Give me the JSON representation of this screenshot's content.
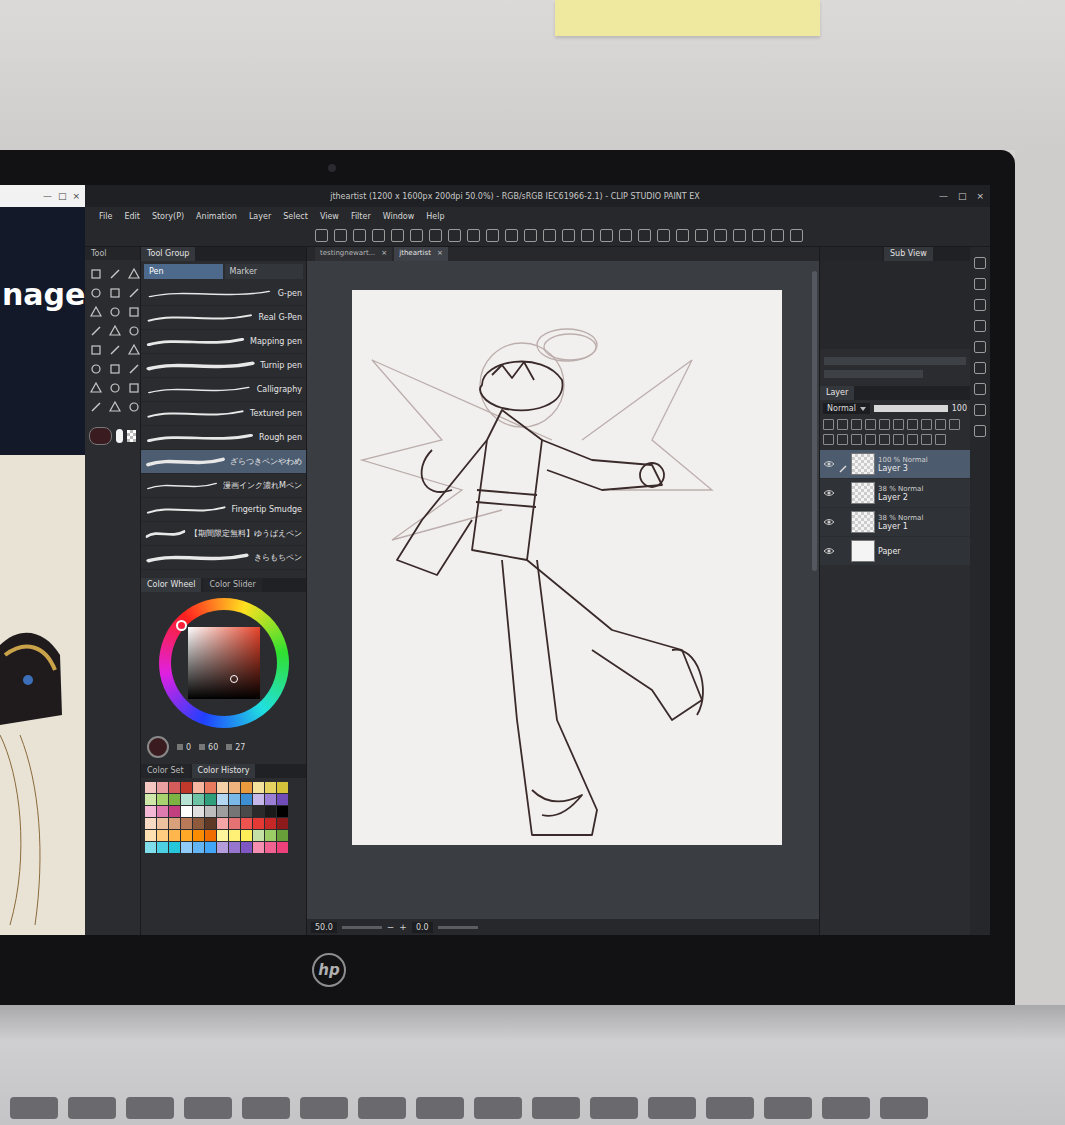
{
  "background_window": {
    "heading": "nage",
    "window_controls": [
      "—",
      "□",
      "×"
    ]
  },
  "app": {
    "title": "jtheartist (1200 x 1600px 200dpi 50.0%)  - RGB/sRGB IEC61966-2.1) - CLIP STUDIO PAINT EX",
    "window_controls": [
      "—",
      "□",
      "×"
    ],
    "menu": [
      "File",
      "Edit",
      "Story(P)",
      "Animation",
      "Layer",
      "Select",
      "View",
      "Filter",
      "Window",
      "Help"
    ],
    "tool_panel": {
      "title": "Tool"
    },
    "sub_tool": {
      "tabs": [
        {
          "label": "Tool Group",
          "selected": true
        }
      ],
      "groups": [
        {
          "label": "Pen",
          "selected": true
        },
        {
          "label": "Marker",
          "selected": false
        }
      ],
      "brushes": [
        {
          "label": "G-pen",
          "selected": false
        },
        {
          "label": "Real G-Pen",
          "selected": false
        },
        {
          "label": "Mapping pen",
          "selected": false
        },
        {
          "label": "Turnip pen",
          "selected": false
        },
        {
          "label": "Calligraphy",
          "selected": false
        },
        {
          "label": "Textured pen",
          "selected": false
        },
        {
          "label": "Rough pen",
          "selected": false
        },
        {
          "label": "ざらつきペンやわめ",
          "selected": true
        },
        {
          "label": "漫画インク濃れMペン",
          "selected": false
        },
        {
          "label": "Fingertip Smudge",
          "selected": false
        },
        {
          "label": "【期間限定無料】ゆうばえペン",
          "selected": false
        },
        {
          "label": "きらもちペン",
          "selected": false
        }
      ]
    },
    "color": {
      "tabs": [
        {
          "label": "Color Wheel",
          "selected": true
        },
        {
          "label": "Color Slider",
          "selected": false
        }
      ],
      "current": "#3a1c20",
      "values": [
        "0",
        "60",
        "27"
      ]
    },
    "palette": {
      "tabs": [
        {
          "label": "Color Set",
          "selected": false
        },
        {
          "label": "Color History",
          "selected": true
        }
      ],
      "swatches": [
        "#f4c7c3",
        "#e8a0a0",
        "#d65b5b",
        "#c0392b",
        "#f7b6a0",
        "#e87a5d",
        "#f5d0a9",
        "#f0b37e",
        "#e89a3c",
        "#f3e39c",
        "#e6d260",
        "#d4c23a",
        "#cfe8a9",
        "#a9d36e",
        "#7cb342",
        "#b6e3d4",
        "#6cc4a4",
        "#2e9e7b",
        "#b3d7f2",
        "#7ab8e8",
        "#3d8fd1",
        "#c7b8ea",
        "#9b7fd4",
        "#6f4cb8",
        "#f2b8d6",
        "#e07bb0",
        "#c2407f",
        "#ffffff",
        "#e0e0e0",
        "#bdbdbd",
        "#9e9e9e",
        "#757575",
        "#4a4a4a",
        "#2b2b2b",
        "#1a1a1a",
        "#000000",
        "#f8d9c4",
        "#eec1a1",
        "#d9a07c",
        "#b87a58",
        "#8d5a3c",
        "#5e3a26",
        "#f4a6a6",
        "#e57373",
        "#ef5350",
        "#e53935",
        "#c62828",
        "#8e1b1b",
        "#ffe0b2",
        "#ffcc80",
        "#ffb74d",
        "#ffa726",
        "#fb8c00",
        "#ef6c00",
        "#fff59d",
        "#fff176",
        "#ffee58",
        "#c5e1a5",
        "#9ccc65",
        "#689f38",
        "#80deea",
        "#4dd0e1",
        "#26c6da",
        "#90caf9",
        "#64b5f6",
        "#42a5f5",
        "#b39ddb",
        "#9575cd",
        "#7e57c2",
        "#f48fb1",
        "#f06292",
        "#ec407a"
      ]
    },
    "canvas_tabs": [
      {
        "label": "testingnewart...",
        "selected": false
      },
      {
        "label": "jtheartist",
        "selected": true
      }
    ],
    "tab_close": "×",
    "status": {
      "zoom": "50.0",
      "zoom_buttons": [
        "−",
        "+"
      ],
      "angle": "0.0"
    },
    "sub_view": {
      "tabs": [
        {
          "label": "Sub View",
          "selected": true
        }
      ]
    },
    "layer_panel": {
      "title": "Layer",
      "blend": "Normal",
      "opacity": "100",
      "layers": [
        {
          "kind": "raster",
          "opacity": "100 %",
          "blend": "Normal",
          "name": "Layer 3",
          "visible": true,
          "selected": true
        },
        {
          "kind": "raster",
          "opacity": "38 %",
          "blend": "Normal",
          "name": "Layer 2",
          "visible": true,
          "selected": false
        },
        {
          "kind": "raster",
          "opacity": "38 %",
          "blend": "Normal",
          "name": "Layer 1",
          "visible": true,
          "selected": false
        },
        {
          "kind": "paper",
          "name": "Paper",
          "visible": true,
          "selected": false
        }
      ]
    }
  },
  "laptop": {
    "logo": "hp"
  }
}
